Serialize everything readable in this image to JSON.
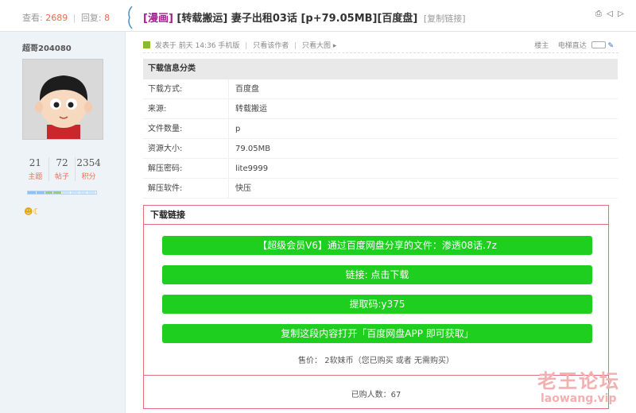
{
  "header": {
    "views_label": "查看:",
    "views_value": "2689",
    "replies_label": "回复:",
    "replies_value": "8",
    "title_tag": "[漫画]",
    "title_text": "[转载搬运] 妻子出租03话 [p+79.05MB][百度盘]",
    "copy_link": "[复制链接]"
  },
  "user": {
    "name": "超哥204080",
    "stats": [
      {
        "value": "21",
        "label": "主题"
      },
      {
        "value": "72",
        "label": "帖子"
      },
      {
        "value": "2354",
        "label": "积分"
      }
    ]
  },
  "postmeta": {
    "posted": "发表于 前天 14:36 手机版",
    "author_only": "只看该作者",
    "big_image": "只看大图",
    "floor": "楼主",
    "jump": "电梯直达"
  },
  "info": {
    "header": "下载信息分类",
    "rows": [
      {
        "key": "下载方式:",
        "value": "百度盘"
      },
      {
        "key": "来源:",
        "value": "转载搬运"
      },
      {
        "key": "文件数量:",
        "value": "p"
      },
      {
        "key": "资源大小:",
        "value": "79.05MB"
      },
      {
        "key": "解压密码:",
        "value": "lite9999"
      },
      {
        "key": "解压软件:",
        "value": "快压"
      }
    ]
  },
  "download": {
    "header": "下载链接",
    "buttons": [
      "【超级会员V6】通过百度网盘分享的文件：渗透08话.7z",
      "链接: 点击下载",
      "提取码:y375",
      "复制这段内容打开「百度网盘APP 即可获取」"
    ],
    "price": "售价： 2软妹币（您已购买 或者 无需购买）",
    "buyers": "已购人数：67"
  },
  "watermark": {
    "cn": "老王论坛",
    "url": "laowang.vip"
  },
  "colors": {
    "button": "#1fcf1f",
    "title_tag": "#a31d8f",
    "accent": "#f26c4f",
    "box_border": "#e0707a"
  }
}
